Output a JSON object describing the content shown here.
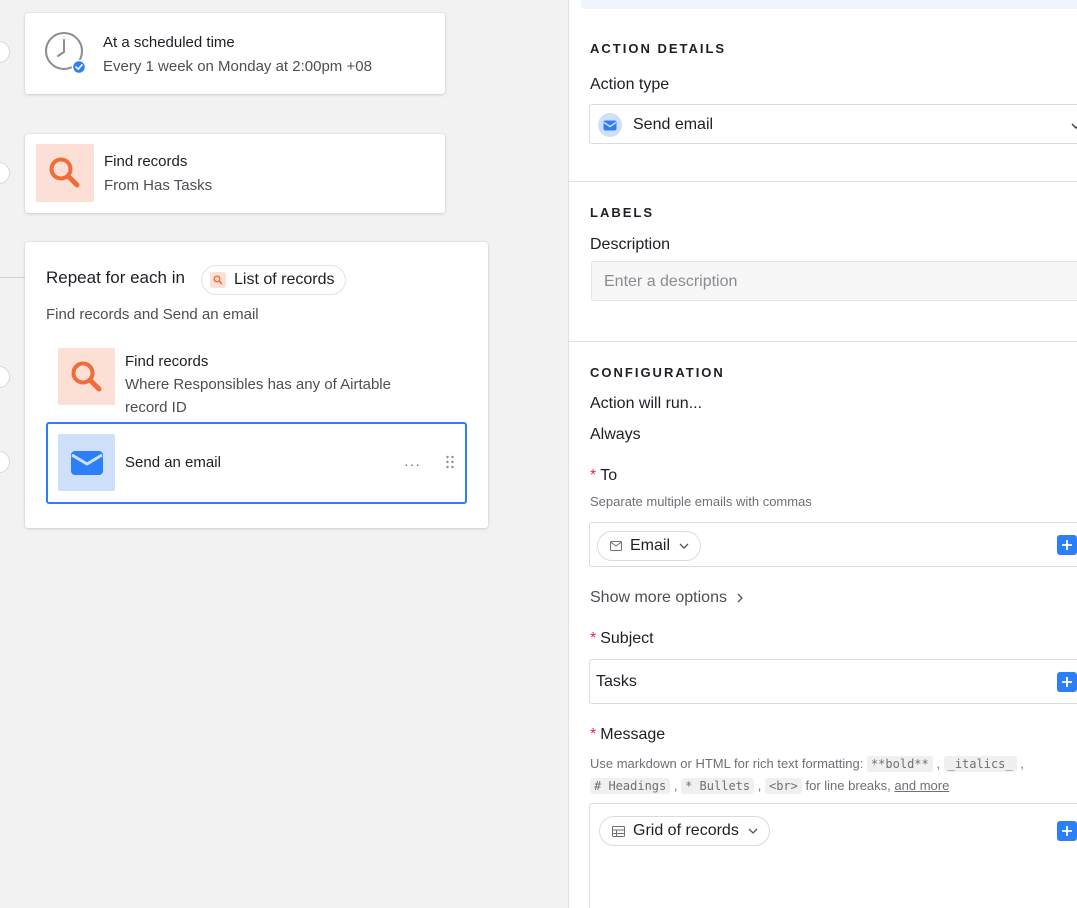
{
  "canvas": {
    "trigger": {
      "title": "At a scheduled time",
      "subtitle": "Every 1 week on Monday at 2:00pm +08",
      "icon": "clock-icon"
    },
    "find_records_1": {
      "title": "Find records",
      "subtitle": "From Has Tasks",
      "icon": "search-icon"
    },
    "repeat": {
      "title": "Repeat for each in",
      "pill_label": "List of records",
      "subtitle": "Find records and Send an email",
      "find_records_2": {
        "title": "Find records",
        "subtitle_line1": "Where Responsibles has any of Airtable",
        "subtitle_line2": "record ID"
      },
      "send_email": {
        "title": "Send an email",
        "more": "···"
      }
    }
  },
  "panel": {
    "action_details": {
      "heading": "ACTION DETAILS",
      "action_type_label": "Action type",
      "action_type_value": "Send email"
    },
    "labels": {
      "heading": "LABELS",
      "description_label": "Description",
      "description_placeholder": "Enter a description"
    },
    "configuration": {
      "heading": "CONFIGURATION",
      "runs_label": "Action will run...",
      "runs_value": "Always",
      "to_label": "To",
      "to_hint": "Separate multiple emails with commas",
      "to_token": "Email",
      "show_more": "Show more options",
      "subject_label": "Subject",
      "subject_value": "Tasks",
      "message_label": "Message",
      "message_hint_1": "Use markdown or HTML for rich text formatting:",
      "code_bold": "**bold**",
      "code_italics": "_italics_",
      "code_headings": "# Headings",
      "code_bullets": "* Bullets",
      "code_br": "<br>",
      "message_hint_2": "for line breaks,",
      "message_hint_link": "and more",
      "message_token": "Grid of records"
    },
    "required_mark": "*"
  },
  "colors": {
    "accent": "#2d7ff9",
    "orange": "#f26b3a",
    "orange_tile": "#fde0d5",
    "blue_tile": "#cfe0fb",
    "required": "#e0294b"
  }
}
